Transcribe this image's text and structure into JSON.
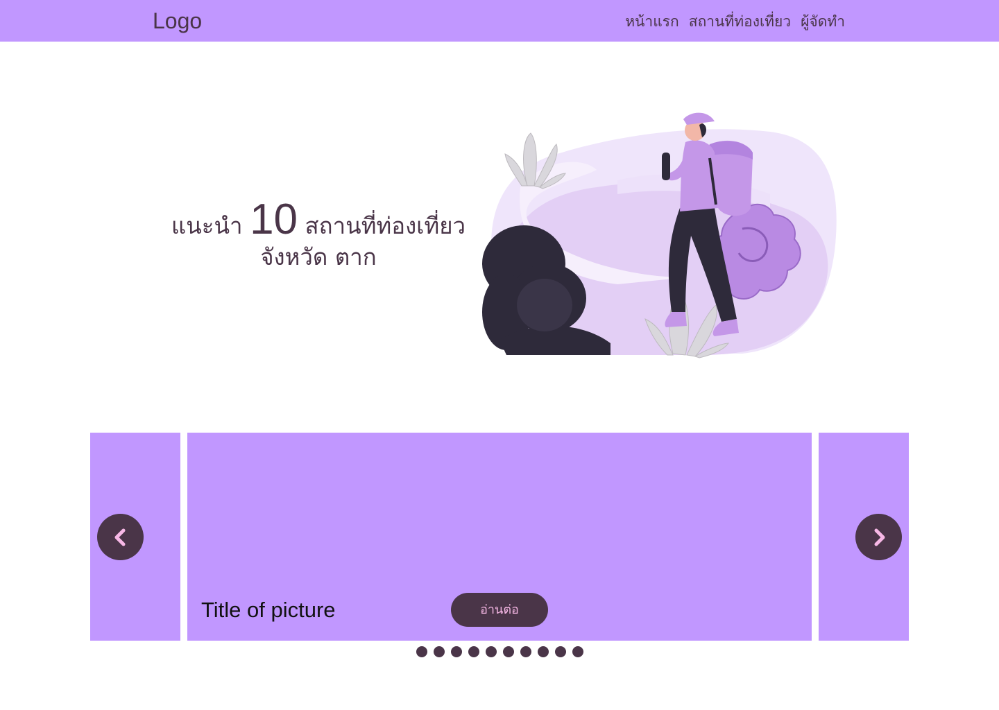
{
  "header": {
    "logo": "Logo",
    "nav": [
      "หน้าแรก",
      "สถานที่ท่องเที่ยว",
      "ผู้จัดทำ"
    ]
  },
  "hero": {
    "prefix": "แนะนำ",
    "number": "10",
    "suffix": "สถานที่ท่องเที่ยว",
    "line2": "จังหวัด ตาก",
    "illustration": "hiker-with-backpack-illustration"
  },
  "carousel": {
    "slide_title": "Title of picture",
    "read_more": "อ่านต่อ",
    "prev_icon": "chevron-left-icon",
    "next_icon": "chevron-right-icon",
    "dot_count": 10
  },
  "colors": {
    "accent": "#c197ff",
    "dark": "#4a3548",
    "button_text": "#f7b8e6"
  }
}
